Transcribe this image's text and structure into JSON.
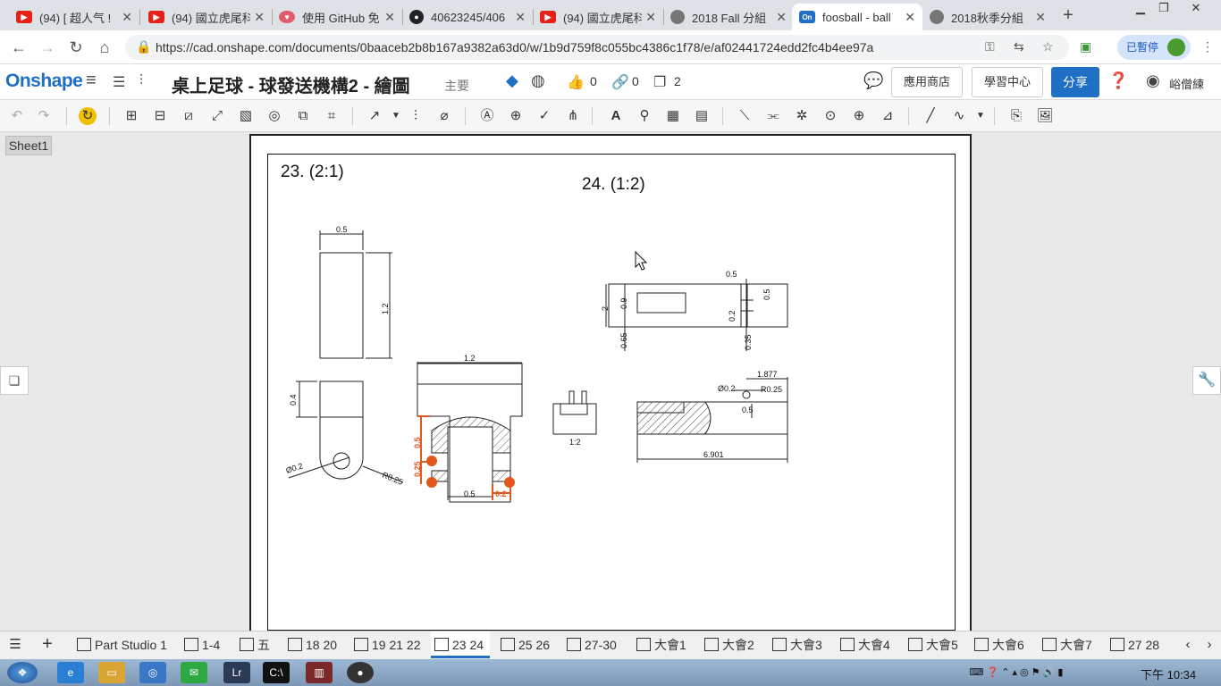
{
  "browser": {
    "tabs": [
      {
        "label": "(94) [ 超人气 ! ",
        "icon": "youtube-icon",
        "color": "#e62117"
      },
      {
        "label": "(94) 國立虎尾科",
        "icon": "youtube-icon",
        "color": "#e62117"
      },
      {
        "label": "使用 GitHub 免",
        "icon": "heart-icon",
        "color": "#e25b6b"
      },
      {
        "label": "40623245/406",
        "icon": "github-icon",
        "color": "#222222"
      },
      {
        "label": "(94) 國立虎尾科",
        "icon": "youtube-icon",
        "color": "#e62117"
      },
      {
        "label": "2018 Fall 分組",
        "icon": "globe-icon",
        "color": "#555555"
      },
      {
        "label": "foosball - ball",
        "icon": "onshape-icon",
        "color": "#1f6fc5"
      },
      {
        "label": "2018秋季分組",
        "icon": "globe-icon",
        "color": "#555555"
      }
    ],
    "url": "https://cad.onshape.com/documents/0baaceb2b8b167a9382a63d0/w/1b9d759f8c055bc4386c1f78/e/af02441724edd2fc4b4ee97a",
    "paused_label": "已暫停"
  },
  "header": {
    "logo": "Onshape",
    "title": "桌上足球 - 球發送機構2 - 繪圖",
    "subtitle": "主要",
    "likes": "0",
    "links": "0",
    "copies": "2",
    "app_store": "應用商店",
    "learning_center": "學習中心",
    "share": "分享",
    "user": "峪僧練"
  },
  "drawing": {
    "sheet_tab": "Sheet1",
    "label_23": "23. (2:1)",
    "label_24": "24. (1:2)",
    "dims": {
      "d05a": "0.5",
      "d12a": "1.2",
      "d04": "0.4",
      "d02a": "Ø0.2",
      "dr025a": "R0.25",
      "d12b": "1.2",
      "d05b": "0.5",
      "d025": "0.25",
      "d05c": "0.5",
      "d02b": "0.2",
      "scale12": "1:2",
      "d05d": "0.5",
      "d05e": "0.5",
      "d2": "2",
      "d09": "0.9",
      "d02c": "0.2",
      "d065": "0.65",
      "d035": "0.35",
      "d1877": "1.877",
      "d02d": "Ø0.2",
      "dr025b": "R0.25",
      "d05f": "0.5",
      "d6901": "6.901"
    }
  },
  "bottom_tabs": [
    "Part Studio 1",
    "1-4",
    "五",
    "18 20",
    "19 21 22",
    "23 24",
    "25 26",
    "27-30",
    "大會1",
    "大會2",
    "大會3",
    "大會4",
    "大會5",
    "大會6",
    "大會7",
    "27 28"
  ],
  "taskbar": {
    "clock": "下午 10:34"
  }
}
